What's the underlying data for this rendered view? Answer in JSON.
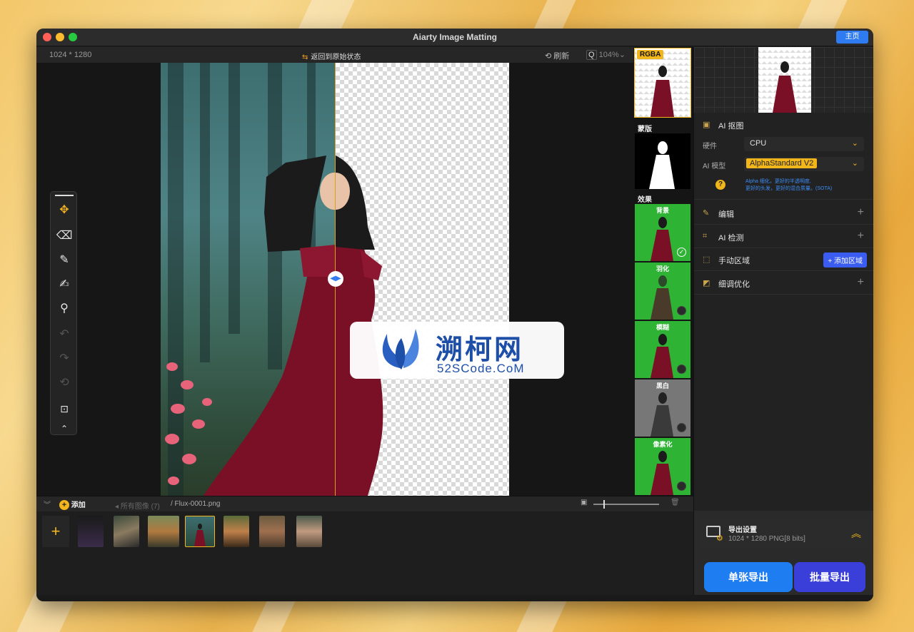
{
  "window": {
    "title": "Aiarty Image Matting",
    "home_label": "主页"
  },
  "canvas": {
    "dims": "1024 * 1280",
    "reset_label": "返回到原始状态",
    "refresh_label": "刷新",
    "zoom": "104%"
  },
  "watermark": {
    "brand": "溯柯网",
    "url": "52SCode.CoM"
  },
  "strip": {
    "rgba_label": "RGBA",
    "mask_label": "蒙版",
    "effects_label": "效果",
    "effects": [
      "背景",
      "羽化",
      "模糊",
      "黑白",
      "像素化"
    ]
  },
  "panel": {
    "ai_matting": "AI 抠图",
    "hardware_label": "硬件",
    "hardware_value": "CPU",
    "model_label": "AI 模型",
    "model_value": "AlphaStandard  V2",
    "model_desc_1": "Alpha 细化，更好的半透明度,",
    "model_desc_2": "更好的头发，更好的混合质量。(SOTA)",
    "edit": "编辑",
    "ai_detect": "AI 检测",
    "manual_region": "手动区域",
    "add_region": "添加区域",
    "refine": "细调优化",
    "export_title": "导出设置",
    "export_info": "1024 * 1280 PNG[8 bits]",
    "export_single": "单张导出",
    "export_batch": "批量导出"
  },
  "bottom": {
    "add_label": "添加",
    "path_all": "所有图像 (7)",
    "path_file": "/ Flux-0001.png"
  },
  "colors": {
    "accent": "#2f7bf2",
    "highlight": "#f2b61d",
    "green_bg": "#2fb335"
  }
}
